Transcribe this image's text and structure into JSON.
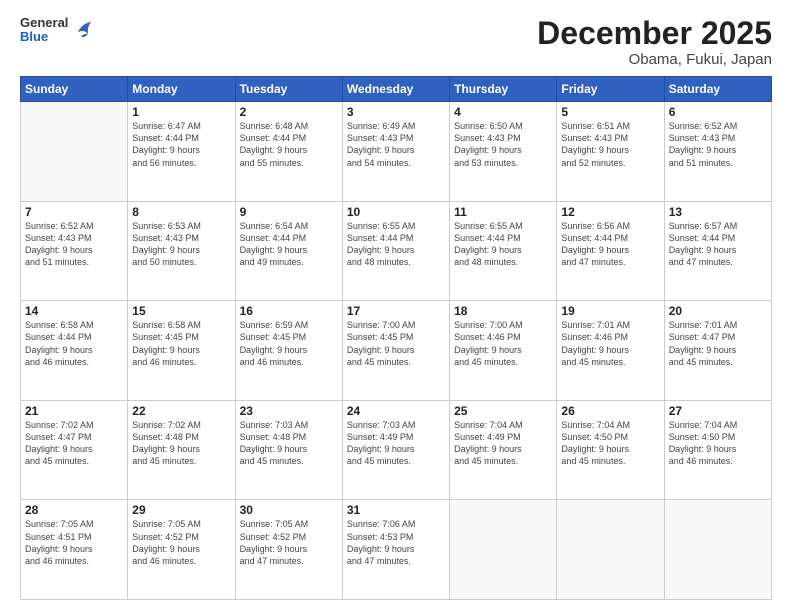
{
  "logo": {
    "general": "General",
    "blue": "Blue"
  },
  "title": "December 2025",
  "subtitle": "Obama, Fukui, Japan",
  "days_header": [
    "Sunday",
    "Monday",
    "Tuesday",
    "Wednesday",
    "Thursday",
    "Friday",
    "Saturday"
  ],
  "weeks": [
    [
      {
        "day": "",
        "info": ""
      },
      {
        "day": "1",
        "info": "Sunrise: 6:47 AM\nSunset: 4:44 PM\nDaylight: 9 hours\nand 56 minutes."
      },
      {
        "day": "2",
        "info": "Sunrise: 6:48 AM\nSunset: 4:44 PM\nDaylight: 9 hours\nand 55 minutes."
      },
      {
        "day": "3",
        "info": "Sunrise: 6:49 AM\nSunset: 4:43 PM\nDaylight: 9 hours\nand 54 minutes."
      },
      {
        "day": "4",
        "info": "Sunrise: 6:50 AM\nSunset: 4:43 PM\nDaylight: 9 hours\nand 53 minutes."
      },
      {
        "day": "5",
        "info": "Sunrise: 6:51 AM\nSunset: 4:43 PM\nDaylight: 9 hours\nand 52 minutes."
      },
      {
        "day": "6",
        "info": "Sunrise: 6:52 AM\nSunset: 4:43 PM\nDaylight: 9 hours\nand 51 minutes."
      }
    ],
    [
      {
        "day": "7",
        "info": "Sunrise: 6:52 AM\nSunset: 4:43 PM\nDaylight: 9 hours\nand 51 minutes."
      },
      {
        "day": "8",
        "info": "Sunrise: 6:53 AM\nSunset: 4:43 PM\nDaylight: 9 hours\nand 50 minutes."
      },
      {
        "day": "9",
        "info": "Sunrise: 6:54 AM\nSunset: 4:44 PM\nDaylight: 9 hours\nand 49 minutes."
      },
      {
        "day": "10",
        "info": "Sunrise: 6:55 AM\nSunset: 4:44 PM\nDaylight: 9 hours\nand 48 minutes."
      },
      {
        "day": "11",
        "info": "Sunrise: 6:55 AM\nSunset: 4:44 PM\nDaylight: 9 hours\nand 48 minutes."
      },
      {
        "day": "12",
        "info": "Sunrise: 6:56 AM\nSunset: 4:44 PM\nDaylight: 9 hours\nand 47 minutes."
      },
      {
        "day": "13",
        "info": "Sunrise: 6:57 AM\nSunset: 4:44 PM\nDaylight: 9 hours\nand 47 minutes."
      }
    ],
    [
      {
        "day": "14",
        "info": "Sunrise: 6:58 AM\nSunset: 4:44 PM\nDaylight: 9 hours\nand 46 minutes."
      },
      {
        "day": "15",
        "info": "Sunrise: 6:58 AM\nSunset: 4:45 PM\nDaylight: 9 hours\nand 46 minutes."
      },
      {
        "day": "16",
        "info": "Sunrise: 6:59 AM\nSunset: 4:45 PM\nDaylight: 9 hours\nand 46 minutes."
      },
      {
        "day": "17",
        "info": "Sunrise: 7:00 AM\nSunset: 4:45 PM\nDaylight: 9 hours\nand 45 minutes."
      },
      {
        "day": "18",
        "info": "Sunrise: 7:00 AM\nSunset: 4:46 PM\nDaylight: 9 hours\nand 45 minutes."
      },
      {
        "day": "19",
        "info": "Sunrise: 7:01 AM\nSunset: 4:46 PM\nDaylight: 9 hours\nand 45 minutes."
      },
      {
        "day": "20",
        "info": "Sunrise: 7:01 AM\nSunset: 4:47 PM\nDaylight: 9 hours\nand 45 minutes."
      }
    ],
    [
      {
        "day": "21",
        "info": "Sunrise: 7:02 AM\nSunset: 4:47 PM\nDaylight: 9 hours\nand 45 minutes."
      },
      {
        "day": "22",
        "info": "Sunrise: 7:02 AM\nSunset: 4:48 PM\nDaylight: 9 hours\nand 45 minutes."
      },
      {
        "day": "23",
        "info": "Sunrise: 7:03 AM\nSunset: 4:48 PM\nDaylight: 9 hours\nand 45 minutes."
      },
      {
        "day": "24",
        "info": "Sunrise: 7:03 AM\nSunset: 4:49 PM\nDaylight: 9 hours\nand 45 minutes."
      },
      {
        "day": "25",
        "info": "Sunrise: 7:04 AM\nSunset: 4:49 PM\nDaylight: 9 hours\nand 45 minutes."
      },
      {
        "day": "26",
        "info": "Sunrise: 7:04 AM\nSunset: 4:50 PM\nDaylight: 9 hours\nand 45 minutes."
      },
      {
        "day": "27",
        "info": "Sunrise: 7:04 AM\nSunset: 4:50 PM\nDaylight: 9 hours\nand 46 minutes."
      }
    ],
    [
      {
        "day": "28",
        "info": "Sunrise: 7:05 AM\nSunset: 4:51 PM\nDaylight: 9 hours\nand 46 minutes."
      },
      {
        "day": "29",
        "info": "Sunrise: 7:05 AM\nSunset: 4:52 PM\nDaylight: 9 hours\nand 46 minutes."
      },
      {
        "day": "30",
        "info": "Sunrise: 7:05 AM\nSunset: 4:52 PM\nDaylight: 9 hours\nand 47 minutes."
      },
      {
        "day": "31",
        "info": "Sunrise: 7:06 AM\nSunset: 4:53 PM\nDaylight: 9 hours\nand 47 minutes."
      },
      {
        "day": "",
        "info": ""
      },
      {
        "day": "",
        "info": ""
      },
      {
        "day": "",
        "info": ""
      }
    ]
  ]
}
